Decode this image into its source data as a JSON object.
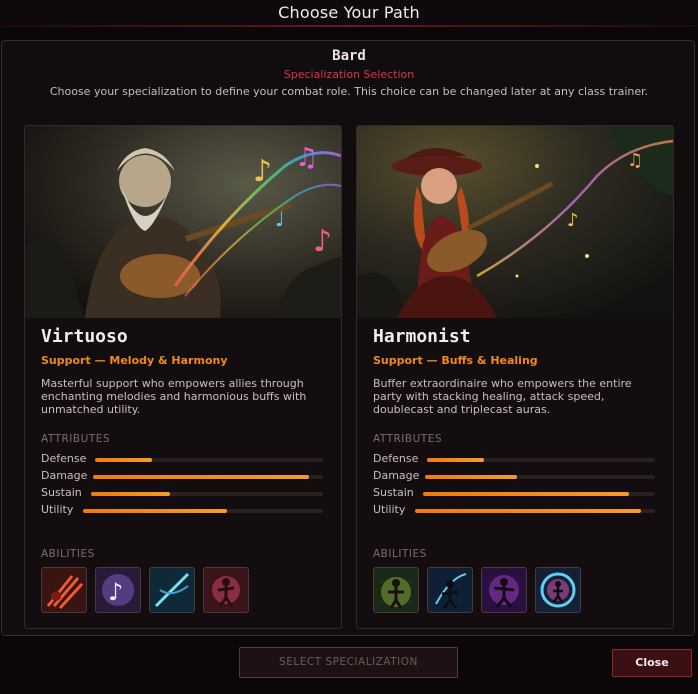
{
  "window": {
    "title": "Choose Your Path"
  },
  "header": {
    "class_name": "Bard",
    "subtitle": "Specialization Selection",
    "description": "Choose your specialization to define your combat role. This choice can be changed later at any class trainer."
  },
  "cards": [
    {
      "name": "Virtuoso",
      "role": "Support — Melody & Harmony",
      "description": "Masterful support who empowers allies through enchanting melodies and harmonious buffs with unmatched utility.",
      "attributes_label": "ATTRIBUTES",
      "stats": [
        {
          "label": "Defense",
          "value": 0.25
        },
        {
          "label": "Damage",
          "value": 0.94
        },
        {
          "label": "Sustain",
          "value": 0.34
        },
        {
          "label": "Utility",
          "value": 0.6
        }
      ],
      "abilities_label": "ABILITIES",
      "abilities": [
        "red-slash-ability-icon",
        "purple-music-note-ability-icon",
        "blue-sword-ability-icon",
        "red-dancer-ability-icon"
      ]
    },
    {
      "name": "Harmonist",
      "role": "Support — Buffs & Healing",
      "description": "Buffer extraordinaire who empowers the entire party with stacking healing, attack speed, doublecast and triplecast auras.",
      "attributes_label": "ATTRIBUTES",
      "stats": [
        {
          "label": "Defense",
          "value": 0.25
        },
        {
          "label": "Damage",
          "value": 0.4
        },
        {
          "label": "Sustain",
          "value": 0.89
        },
        {
          "label": "Utility",
          "value": 0.94
        }
      ],
      "abilities_label": "ABILITIES",
      "abilities": [
        "green-aura-ability-icon",
        "blue-bard-ability-icon",
        "purple-dancer-ability-icon",
        "cyan-ring-ability-icon"
      ]
    }
  ],
  "footer": {
    "select_label": "SELECT SPECIALIZATION",
    "close_label": "Close"
  },
  "colors": {
    "accent_orange": "#f08a1c",
    "accent_red": "#d8344a",
    "panel_bg": "#110c0d"
  }
}
